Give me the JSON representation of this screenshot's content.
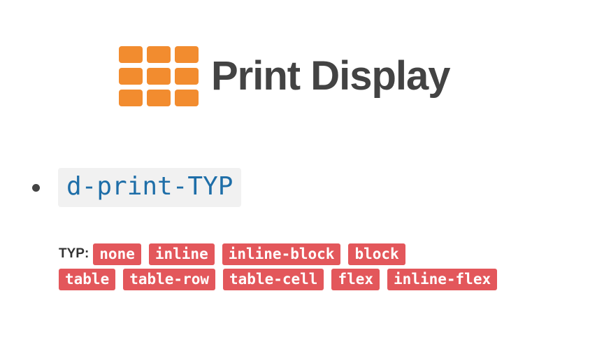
{
  "header": {
    "icon": "grid-icon",
    "icon_color": "#f28c2f",
    "title": "Print Display"
  },
  "utility": {
    "class_name": "d-print-TYP",
    "color": "#1e6ea8"
  },
  "typ": {
    "label": "TYP:",
    "tag_color": "#e3575b",
    "rows": [
      [
        "none",
        "inline",
        "inline-block",
        "block"
      ],
      [
        "table",
        "table-row",
        "table-cell",
        "flex",
        "inline-flex"
      ]
    ]
  }
}
